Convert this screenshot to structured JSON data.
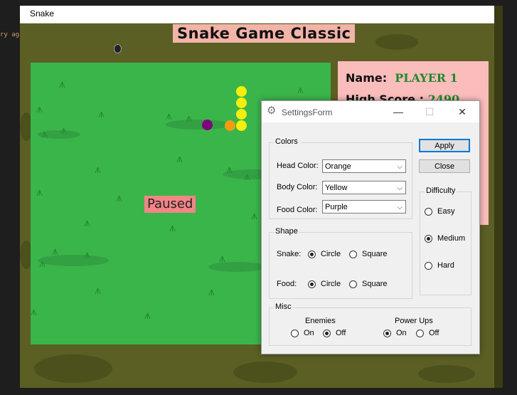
{
  "background_text": "ry aga",
  "window": {
    "title": "Snake"
  },
  "game": {
    "title": "Snake Game Classic",
    "status": "Paused",
    "info": {
      "name_label": "Name:",
      "name_value": "PLAYER 1",
      "high_score_label": "High Score :",
      "high_score_value": "2490"
    },
    "colors": {
      "head": "#f39c12",
      "body": "#f4ef0c",
      "food": "#800080",
      "field": "#3ab54a"
    }
  },
  "settings": {
    "title": "SettingsForm",
    "icon": "gear-icon",
    "minimize": "—",
    "maximize": "☐",
    "close": "✕",
    "colors_group": "Colors",
    "head_color_label": "Head Color:",
    "head_color_value": "Orange",
    "body_color_label": "Body Color:",
    "body_color_value": "Yellow",
    "food_color_label": "Food Color:",
    "food_color_value": "Purple",
    "apply": "Apply",
    "close_btn": "Close",
    "difficulty_group": "Difficulty",
    "difficulty": [
      {
        "label": "Easy",
        "checked": false
      },
      {
        "label": "Medium",
        "checked": true
      },
      {
        "label": "Hard",
        "checked": false
      }
    ],
    "shape_group": "Shape",
    "snake_label": "Snake:",
    "food_label": "Food:",
    "circle": "Circle",
    "square": "Square",
    "snake_shape": "Circle",
    "food_shape": "Circle",
    "misc_group": "Misc",
    "enemies_label": "Enemies",
    "powerups_label": "Power Ups",
    "on": "On",
    "off": "Off",
    "enemies_value": "Off",
    "powerups_value": "On",
    "chevron": "⌵"
  }
}
